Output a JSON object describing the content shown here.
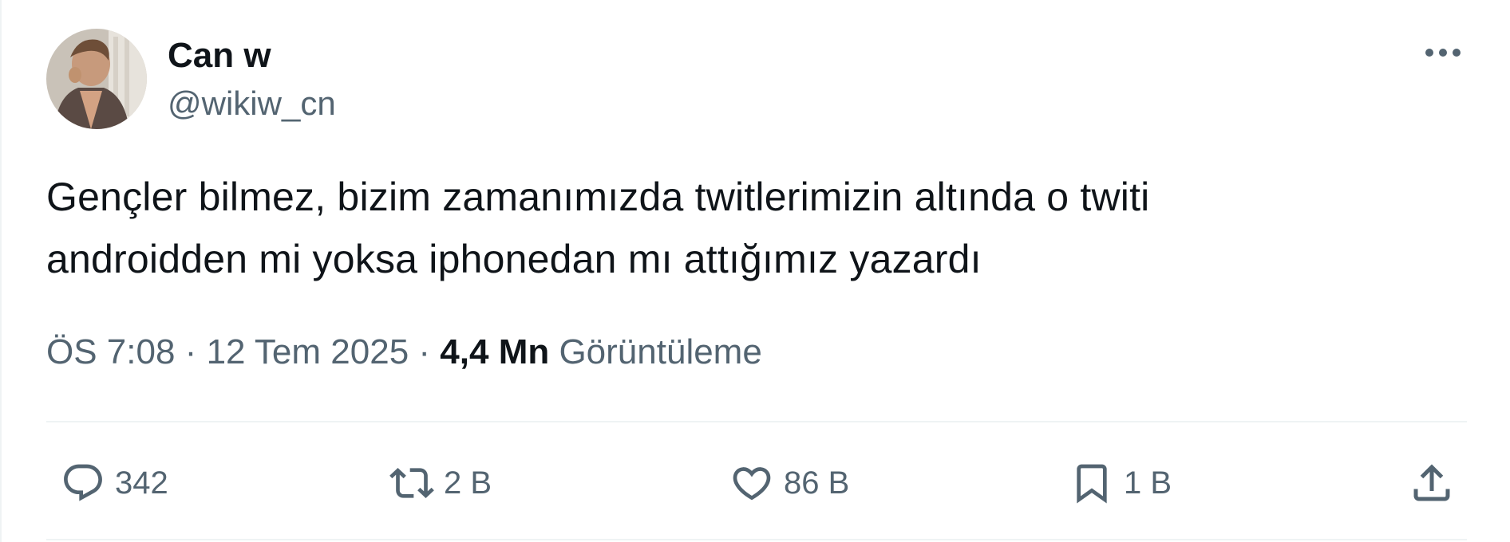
{
  "author": {
    "display_name": "Can w",
    "handle": "@wikiw_cn",
    "avatar_icon": "profile-photo"
  },
  "tweet": {
    "text": "Gençler bilmez, bizim zamanımızda twitlerimizin altında o twiti\nandroidden mi yoksa iphonedan mı attığımız yazardı"
  },
  "meta": {
    "time": "ÖS 7:08",
    "separator": "·",
    "date": "12 Tem 2025",
    "views_count": "4,4 Mn",
    "views_label": "Görüntüleme"
  },
  "actions": {
    "reply": {
      "icon": "reply-icon",
      "count": "342"
    },
    "retweet": {
      "icon": "retweet-icon",
      "count": "2 B"
    },
    "like": {
      "icon": "heart-icon",
      "count": "86 B"
    },
    "bookmark": {
      "icon": "bookmark-icon",
      "count": "1 B"
    },
    "share": {
      "icon": "share-icon"
    }
  },
  "colors": {
    "primary_text": "#0f1419",
    "secondary_text": "#536471",
    "divider": "#eff3f4"
  }
}
